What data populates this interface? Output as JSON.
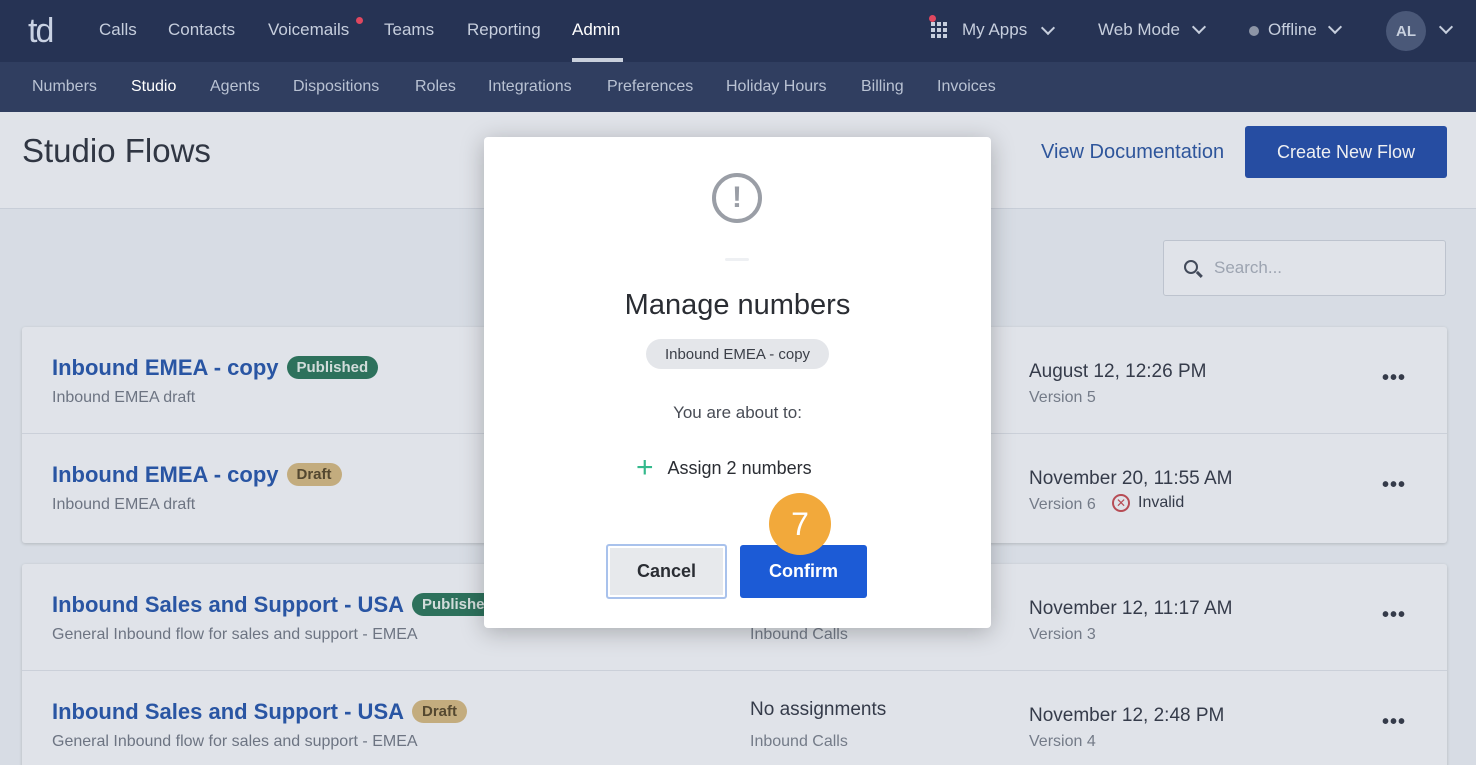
{
  "brand": {
    "logo_text": "td"
  },
  "top_nav": {
    "items": [
      "Calls",
      "Contacts",
      "Voicemails",
      "Teams",
      "Reporting",
      "Admin"
    ],
    "active": "Admin",
    "my_apps": "My Apps",
    "web_mode": "Web Mode",
    "status": "Offline",
    "avatar_initials": "AL"
  },
  "sub_nav": {
    "items": [
      "Numbers",
      "Studio",
      "Agents",
      "Dispositions",
      "Roles",
      "Integrations",
      "Preferences",
      "Holiday Hours",
      "Billing",
      "Invoices"
    ],
    "active": "Studio"
  },
  "header": {
    "title": "Studio Flows",
    "view_docs": "View Documentation",
    "create_flow": "Create New Flow"
  },
  "search": {
    "placeholder": "Search..."
  },
  "flows": [
    {
      "name": "Inbound EMEA - copy",
      "status": "Published",
      "description": "Inbound EMEA draft",
      "date": "August 12, 12:26 PM",
      "version": "Version 5"
    },
    {
      "name": "Inbound EMEA - copy",
      "status": "Draft",
      "description": "Inbound EMEA draft",
      "date": "November 20, 11:55 AM",
      "version": "Version 6",
      "validity": "Invalid"
    },
    {
      "name": "Inbound Sales and Support - USA",
      "status": "Published",
      "description": "General Inbound flow for sales and support - EMEA",
      "assignment_sub": "Inbound Calls",
      "date": "November 12, 11:17 AM",
      "version": "Version 3"
    },
    {
      "name": "Inbound Sales and Support - USA",
      "status": "Draft",
      "description": "General Inbound flow for sales and support - EMEA",
      "assignment": "No assignments",
      "assignment_sub": "Inbound Calls",
      "date": "November 12, 2:48 PM",
      "version": "Version 4"
    }
  ],
  "more_glyph": "•••",
  "modal": {
    "icon": "!",
    "title": "Manage numbers",
    "chip": "Inbound EMEA - copy",
    "about": "You are about to:",
    "action_icon": "+",
    "action": "Assign 2 numbers",
    "cancel": "Cancel",
    "confirm": "Confirm"
  },
  "step_badge": "7",
  "colors": {
    "nav_bg": "#263354",
    "subnav_bg": "#303e60",
    "primary": "#1c5bd6",
    "published": "#236f55",
    "draft": "#cdb27c",
    "step_badge": "#f2a93b"
  }
}
